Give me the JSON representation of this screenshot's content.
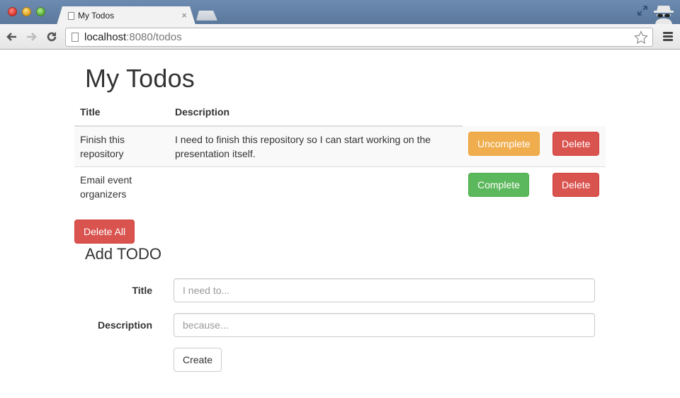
{
  "browser": {
    "tab_title": "My Todos",
    "tab_close": "×",
    "url_host": "localhost",
    "url_rest": ":8080/todos",
    "icons": {
      "back": "back-arrow-icon",
      "forward": "forward-arrow-icon",
      "reload": "reload-icon",
      "bookmark": "star-icon",
      "menu": "hamburger-menu-icon",
      "fullscreen": "fullscreen-icon",
      "incognito": "incognito-icon"
    }
  },
  "page": {
    "title": "My Todos",
    "table": {
      "headers": [
        "Title",
        "Description",
        "",
        ""
      ],
      "rows": [
        {
          "title": "Finish this repository",
          "description": "I need to finish this repository so I can start working on the presentation itself.",
          "toggle_label": "Uncomplete",
          "toggle_state": "completed",
          "delete_label": "Delete"
        },
        {
          "title": "Email event organizers",
          "description": "",
          "toggle_label": "Complete",
          "toggle_state": "incomplete",
          "delete_label": "Delete"
        }
      ]
    },
    "delete_all_label": "Delete All",
    "add_form": {
      "heading": "Add TODO",
      "title_label": "Title",
      "title_placeholder": "I need to...",
      "title_value": "",
      "description_label": "Description",
      "description_placeholder": "because...",
      "description_value": "",
      "submit_label": "Create"
    }
  },
  "colors": {
    "warning": "#f0ad4e",
    "success": "#5cb85c",
    "danger": "#d9534f",
    "chrome_frame": "#5f7ea3"
  }
}
